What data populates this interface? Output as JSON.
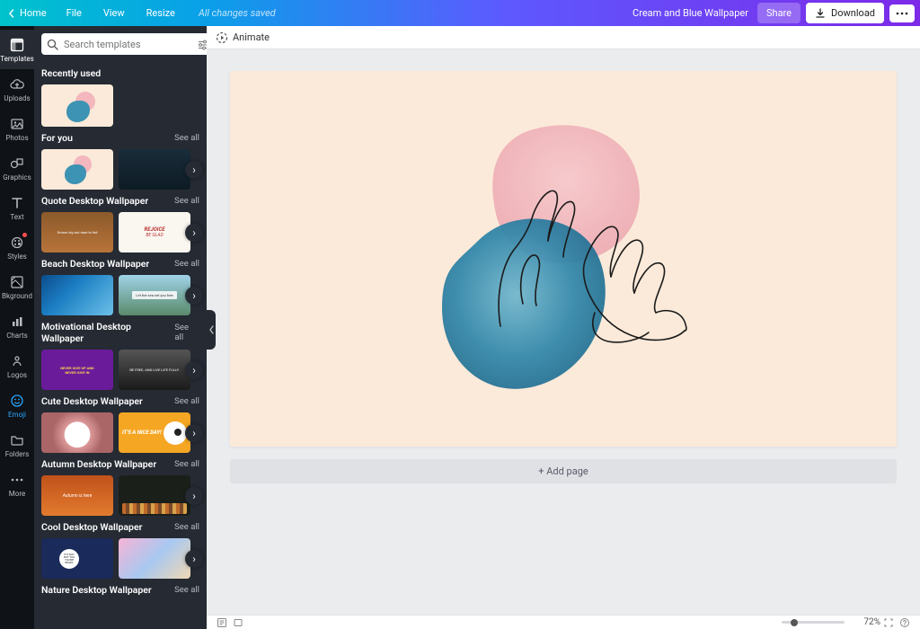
{
  "topbar": {
    "home": "Home",
    "file": "File",
    "view": "View",
    "resize": "Resize",
    "status": "All changes saved",
    "doc_title": "Cream and Blue Wallpaper",
    "share": "Share",
    "download": "Download"
  },
  "rail": {
    "templates": "Templates",
    "uploads": "Uploads",
    "photos": "Photos",
    "graphics": "Graphics",
    "text": "Text",
    "styles": "Styles",
    "bkground": "Bkground",
    "charts": "Charts",
    "logos": "Logos",
    "emoji": "Emoji",
    "folders": "Folders",
    "more": "More"
  },
  "panel": {
    "search_placeholder": "Search templates",
    "recently_used": "Recently used",
    "for_you": "For you",
    "see_all": "See all",
    "categories": {
      "quote": "Quote Desktop Wallpaper",
      "beach": "Beach Desktop Wallpaper",
      "motivational": "Motivational Desktop Wallpaper",
      "cute": "Cute Desktop Wallpaper",
      "autumn": "Autumn Desktop Wallpaper",
      "cool": "Cool Desktop Wallpaper",
      "nature": "Nature Desktop Wallpaper"
    },
    "sample_text": {
      "rejoice": "REJOICE",
      "be_glad": "BE GLAD",
      "nice_day": "IT'S A NICE DAY!",
      "dream_big": "Dream big but dare to fail",
      "never_give_up": "NEVER GIVE UP AND\nNEVER GIVE IN",
      "be_free": "BE FREE, AND LIVE LIFE FULLY.",
      "autumn_here": "Autumn is here",
      "ready": "IT'S NOT\nBUT YOU\nYOU'RE\nREADY"
    }
  },
  "canvas": {
    "animate": "Animate",
    "add_page": "+ Add page",
    "zoom": "72%"
  },
  "colors": {
    "page_bg": "#fbead9",
    "pink_blob": "#f3b7bd",
    "blue_blob": "#3d93b3"
  }
}
